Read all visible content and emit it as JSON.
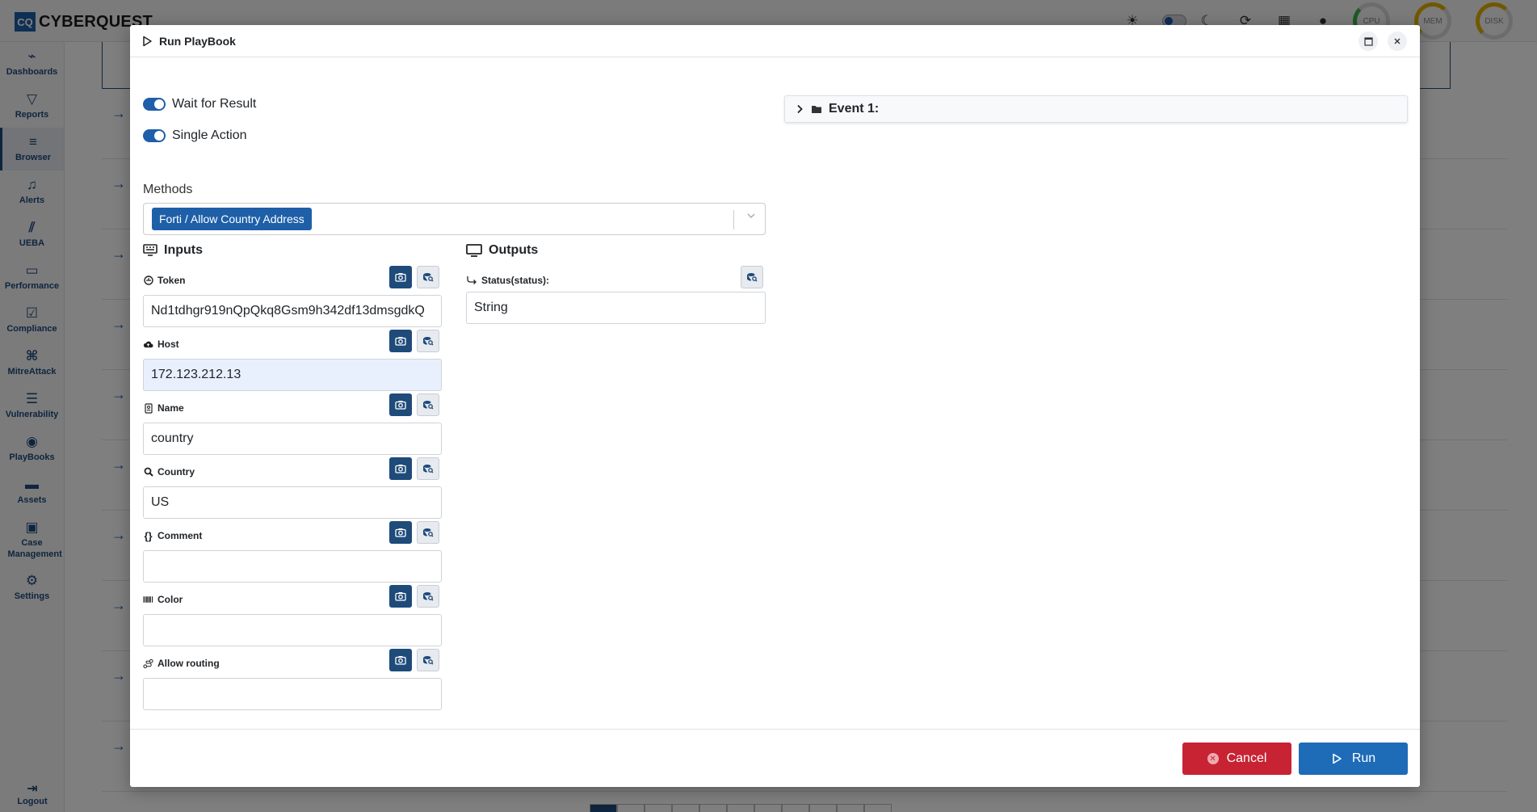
{
  "app": {
    "logo_abbr": "CQ",
    "name": "CYBERQUEST",
    "gauges": [
      {
        "label": "CPU"
      },
      {
        "label": "MEM",
        "max": "100"
      },
      {
        "label": "DISK",
        "min": "0",
        "max": "100"
      }
    ]
  },
  "sidebar": {
    "items": [
      {
        "label": "Dashboards",
        "icon": "chart-line-icon"
      },
      {
        "label": "Reports",
        "icon": "filter-icon"
      },
      {
        "label": "Browser",
        "icon": "list-icon"
      },
      {
        "label": "Alerts",
        "icon": "bell-icon"
      },
      {
        "label": "UEBA",
        "icon": "chart-area-icon"
      },
      {
        "label": "Performance",
        "icon": "keyboard-icon"
      },
      {
        "label": "Compliance",
        "icon": "compliance-icon"
      },
      {
        "label": "MitreAttack",
        "icon": "command-icon"
      },
      {
        "label": "Vulnerability",
        "icon": "server-icon"
      },
      {
        "label": "PlayBooks",
        "icon": "playbook-icon"
      },
      {
        "label": "Assets",
        "icon": "laptop-icon"
      },
      {
        "label": "Case Management",
        "icon": "briefcase-icon"
      },
      {
        "label": "Settings",
        "icon": "gear-icon"
      }
    ],
    "logout": "Logout"
  },
  "modal": {
    "title": "Run PlayBook",
    "wait_for_result": "Wait for Result",
    "single_action": "Single Action",
    "methods_label": "Methods",
    "method_selected": "Forti / Allow Country Address",
    "inputs_title": "Inputs",
    "outputs_title": "Outputs",
    "inputs": [
      {
        "label": "Token",
        "value": "Nd1tdhgr919nQpQkq8Gsm9h342df13dmsgdkQ",
        "icon": "token-icon"
      },
      {
        "label": "Host",
        "value": "172.123.212.13",
        "icon": "cloud-upload-icon"
      },
      {
        "label": "Name",
        "value": "country",
        "icon": "id-badge-icon"
      },
      {
        "label": "Country",
        "value": "US",
        "icon": "search-icon"
      },
      {
        "label": "Comment",
        "value": "",
        "icon": "braces-icon"
      },
      {
        "label": "Color",
        "value": "",
        "icon": "barcode-icon"
      },
      {
        "label": "Allow routing",
        "value": "",
        "icon": "route-icon"
      }
    ],
    "outputs": [
      {
        "label": "Status(status):",
        "value": "String",
        "icon": "return-arrow-icon"
      }
    ],
    "event_label": "Event 1:",
    "cancel_label": "Cancel",
    "run_label": "Run"
  },
  "colors": {
    "primary": "#1e5fa8",
    "navy": "#1e4b7a",
    "danger": "#c82333"
  }
}
